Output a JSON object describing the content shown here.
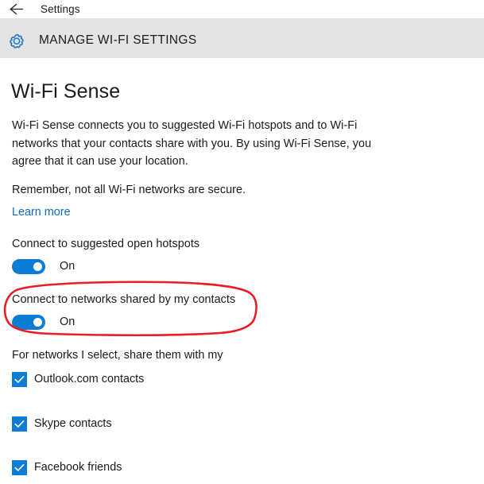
{
  "titlebar": {
    "back_icon": "back-arrow-icon",
    "app_name": "Settings"
  },
  "header": {
    "icon": "gear-icon",
    "title": "MANAGE WI-FI SETTINGS"
  },
  "page": {
    "title": "Wi-Fi Sense",
    "intro_paragraph": "Wi-Fi Sense connects you to suggested Wi-Fi hotspots and to Wi-Fi networks that your contacts share with you. By using Wi-Fi Sense, you agree that it can use your location.",
    "secure_note": "Remember, not all Wi-Fi networks are secure.",
    "learn_more_label": "Learn more"
  },
  "settings": [
    {
      "label": "Connect to suggested open hotspots",
      "state_label": "On",
      "state": "on"
    },
    {
      "label": "Connect to networks shared by my contacts",
      "state_label": "On",
      "state": "on"
    }
  ],
  "share_group": {
    "label": "For networks I select, share them with my",
    "items": [
      {
        "label": "Outlook.com contacts",
        "checked": "true"
      },
      {
        "label": "Skype contacts",
        "checked": "true"
      },
      {
        "label": "Facebook friends",
        "checked": "true"
      }
    ]
  },
  "annotation": {
    "shape": "hand-drawn-ellipse",
    "target": "Connect to networks shared by my contacts"
  },
  "colors": {
    "accent_blue": "#0c7cd5",
    "link_blue": "#0f6cbd",
    "header_band": "#e4e4e4",
    "annotation_red": "#ec1c24",
    "text": "#1a1a1a",
    "background": "#ffffff"
  }
}
